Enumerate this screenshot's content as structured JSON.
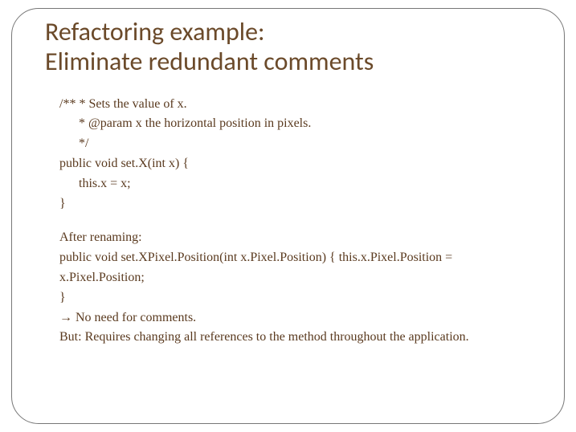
{
  "title": "Refactoring example:\nEliminate redundant comments",
  "code1": {
    "l1": "/** * Sets the value of x.",
    "l2": "* @param x the horizontal position in pixels.",
    "l3": "*/",
    "l4": "public void set.X(int x) {",
    "l5": "this.x = x;",
    "l6": "}"
  },
  "after_label": "After renaming:",
  "code2": {
    "l1": "public void set.XPixel.Position(int x.Pixel.Position) { this.x.Pixel.Position = x.Pixel.Position;",
    "l2": "}"
  },
  "note_arrow": "→",
  "note1": " No need for comments.",
  "note2": "But: Requires changing all references to the method throughout the application."
}
